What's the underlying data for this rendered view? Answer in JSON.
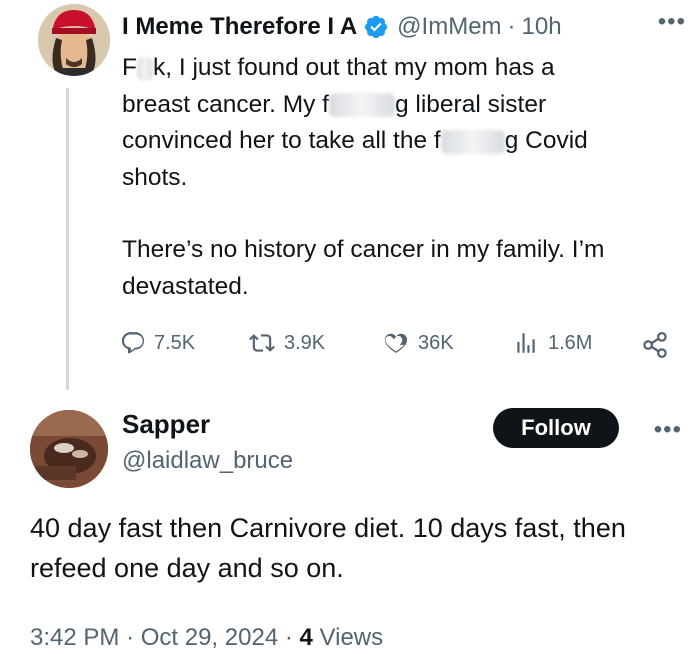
{
  "tweet": {
    "display_name": "I Meme Therefore I A",
    "handle": "@ImMem",
    "separator": "·",
    "time": "10h",
    "more_icon": "more-icon",
    "verified_badge": "verified-badge-icon",
    "text": {
      "l1a": "F",
      "l1b": "k,  I just found out that my mom has a",
      "l2a": "breast cancer. My f",
      "l2b": "g liberal sister",
      "l3a": "convinced her to take all the f",
      "l3b": "g Covid",
      "l4": "shots.",
      "p2": "There’s no history of cancer in my family. I’m devastated."
    },
    "stats": {
      "replies": "7.5K",
      "reposts": "3.9K",
      "likes": "36K",
      "views": "1.6M"
    }
  },
  "reply": {
    "display_name": "Sapper",
    "handle": "@laidlaw_bruce",
    "follow_label": "Follow",
    "text": "40 day fast then Carnivore diet. 10 days fast, then refeed one day and so on.",
    "time": "3:42 PM",
    "date": "Oct 29, 2024",
    "separator": "·",
    "views_count": "4",
    "views_label": "Views"
  },
  "colors": {
    "text": "#0f1419",
    "muted": "#536471",
    "verified": "#1d9bf0",
    "follow_bg": "#0f1419"
  }
}
